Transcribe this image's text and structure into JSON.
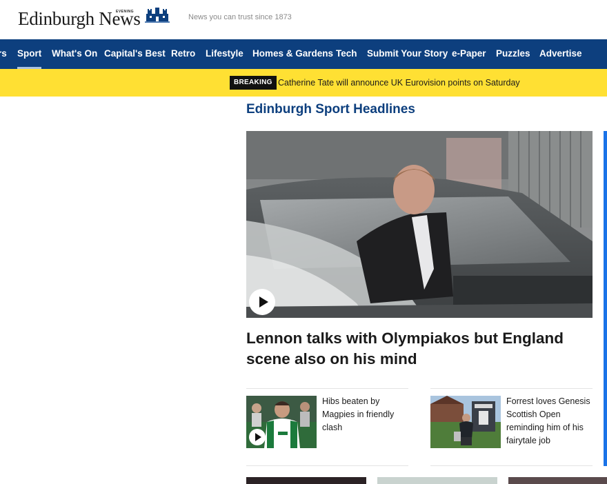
{
  "masthead": {
    "logo_text": "Edinburgh News",
    "logo_small": "EVENING",
    "tagline": "News you can trust since 1873"
  },
  "nav": {
    "items": [
      {
        "label": "rs",
        "active": false
      },
      {
        "label": "Sport",
        "active": true
      },
      {
        "label": "What's On",
        "active": false
      },
      {
        "label": "Capital's Best",
        "active": false
      },
      {
        "label": "Retro",
        "active": false
      },
      {
        "label": "Lifestyle",
        "active": false
      },
      {
        "label": "Homes & Gardens",
        "active": false
      },
      {
        "label": "Tech",
        "active": false
      },
      {
        "label": "Submit Your Story",
        "active": false
      },
      {
        "label": "e-Paper",
        "active": false
      },
      {
        "label": "Puzzles",
        "active": false
      },
      {
        "label": "Advertise",
        "active": false
      }
    ]
  },
  "breaking": {
    "badge": "BREAKING",
    "text": "Catherine Tate will announce UK Eurovision points on Saturday"
  },
  "section": {
    "title": "Edinburgh Sport Headlines",
    "lead": {
      "headline": "Lennon talks with Olympiakos but England scene also on his mind",
      "has_video": true
    },
    "cards": [
      {
        "headline": "Hibs beaten by Magpies in friendly clash",
        "has_video": true
      },
      {
        "headline": "Forrest loves Genesis Scottish Open reminding him of his fairytale job",
        "has_video": false
      }
    ]
  },
  "colors": {
    "nav_bg": "#0d3f7e",
    "breaking_bg": "#ffe033",
    "section_title": "#0d3f7e",
    "accent": "#1a73e8"
  }
}
